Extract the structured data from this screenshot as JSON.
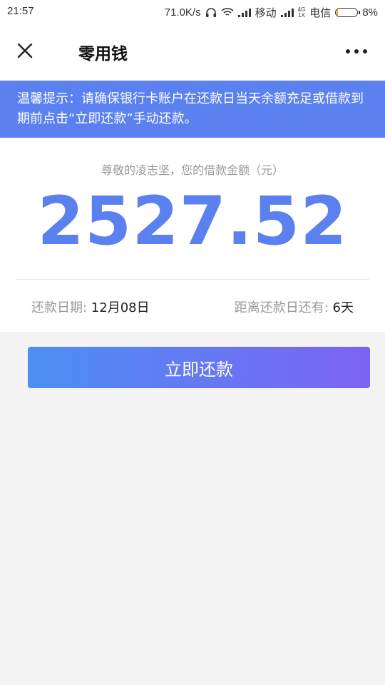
{
  "status_bar": {
    "time": "21:57",
    "net_speed": "71.0K/s",
    "carrier1": "移动",
    "net_type_top": "4G",
    "net_type_bottom": "1X",
    "carrier2": "电信",
    "battery": "8%",
    "battery_level": 0.08
  },
  "nav": {
    "title": "零用钱",
    "close_icon": "close-icon",
    "more_icon": "more-dots-icon"
  },
  "notice": {
    "text": "温馨提示：请确保银行卡账户在还款日当天余额充足或借款到期前点击“立即还款”手动还款。"
  },
  "loan": {
    "greeting": "尊敬的凌志坚，您的借款金额（元）",
    "amount": "2527.52",
    "due_label": "还款日期: ",
    "due_value": "12月08日",
    "days_label": "距离还款日还有: ",
    "days_value": "6天"
  },
  "actions": {
    "repay_label": "立即还款"
  },
  "colors": {
    "accent": "#5b80f0",
    "gradient_start": "#4c8ff4",
    "gradient_end": "#7d63f3"
  }
}
